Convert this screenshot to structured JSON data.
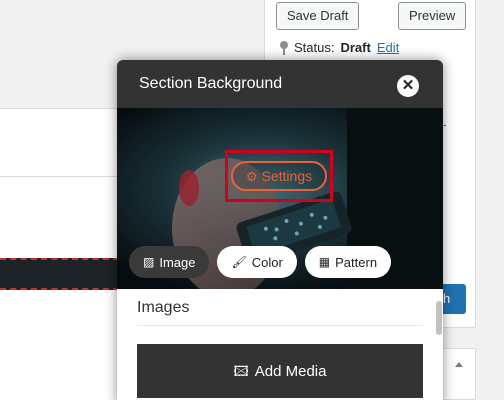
{
  "editor": {
    "save_draft_label": "Save Draft",
    "preview_label": "Preview",
    "status_label": "Status:",
    "status_value": "Draft",
    "status_edit_link": "Edit",
    "publish_label_partial": "h"
  },
  "modal": {
    "title": "Section Background",
    "close_icon": "close-icon",
    "settings_label": "Settings",
    "background_types": [
      {
        "label": "Image",
        "icon": "image-icon",
        "active": true
      },
      {
        "label": "Color",
        "icon": "paint-brush-icon",
        "active": false
      },
      {
        "label": "Pattern",
        "icon": "pattern-icon",
        "active": false
      }
    ],
    "images_heading": "Images",
    "add_media_label": "Add Media"
  },
  "colors": {
    "accent_orange": "#e8623a",
    "highlight_red": "#d0021b",
    "wp_blue": "#2271b1",
    "modal_dark": "#333333"
  }
}
